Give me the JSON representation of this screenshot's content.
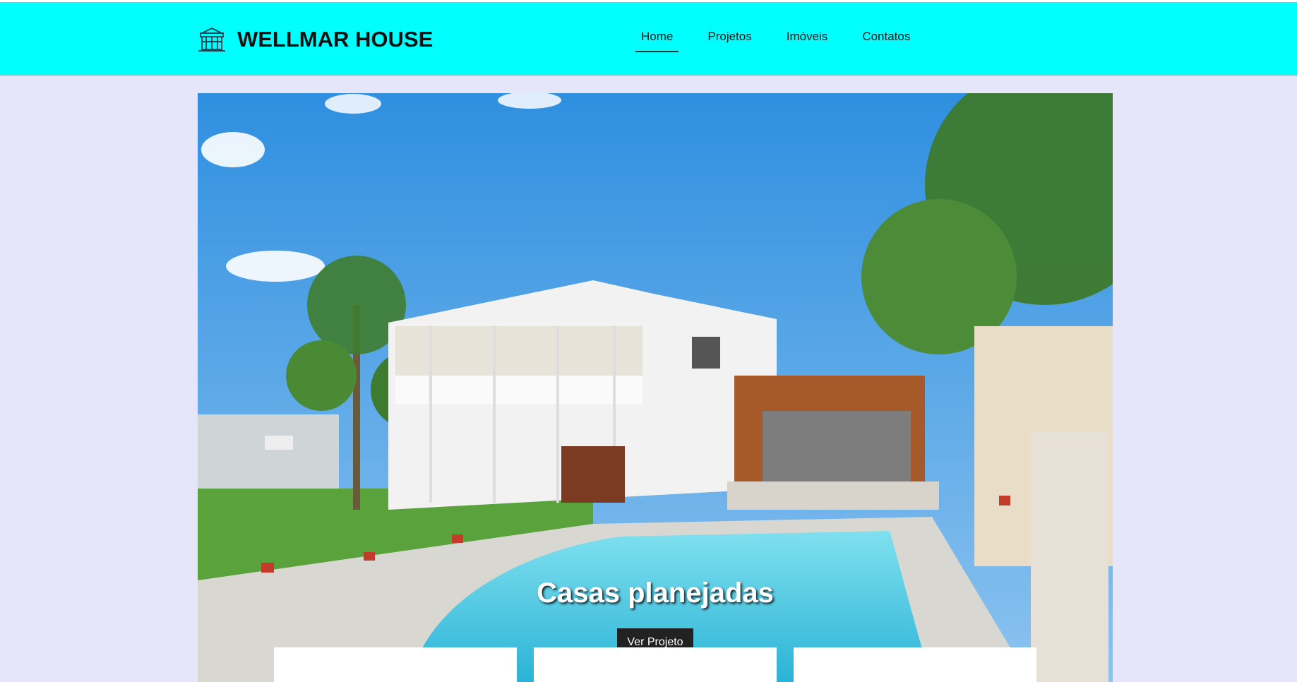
{
  "header": {
    "brand": "WELLMAR HOUSE",
    "logo_icon": "house-icon",
    "bg_color": "#00ffff"
  },
  "nav": {
    "items": [
      {
        "label": "Home",
        "active": true
      },
      {
        "label": "Projetos",
        "active": false
      },
      {
        "label": "Imóveis",
        "active": false
      },
      {
        "label": "Contatos",
        "active": false
      }
    ]
  },
  "hero": {
    "title": "Casas planejadas",
    "button_label": "Ver Projeto",
    "image": "house-with-pool-photo"
  },
  "page": {
    "bg_color": "#e6e6fa"
  }
}
